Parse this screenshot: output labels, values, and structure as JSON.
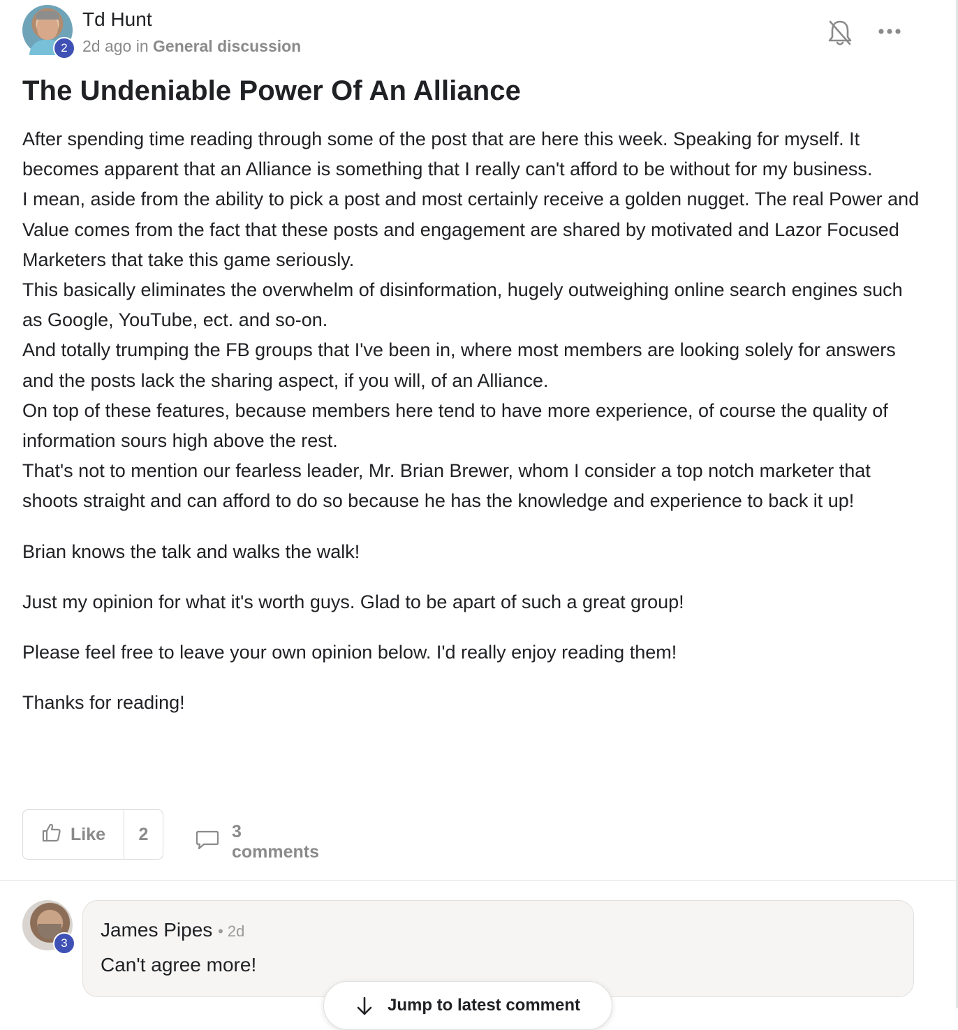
{
  "post": {
    "author": "Td Hunt",
    "author_level": "2",
    "time": "2d ago",
    "in_word": "in",
    "category": "General discussion",
    "title": "The Undeniable Power Of An Alliance",
    "paragraphs": [
      "After spending time reading through some of the post that are here this week. Speaking for myself. It becomes apparent that an Alliance is something that I really can't afford to be without for my business.",
      "I mean, aside from the ability to pick a post and most certainly receive a golden nugget. The real Power and Value comes from the fact that these posts and engagement are shared by motivated and Lazor Focused Marketers that take this game seriously.",
      "This basically eliminates the overwhelm of disinformation, hugely outweighing online search engines such as Google, YouTube, ect. and so-on.",
      "And totally trumping the FB groups that I've been in, where most members are looking solely for answers and the posts lack the sharing aspect, if you will, of an Alliance.",
      "On top of these features, because members here tend to have more experience, of course the quality of information sours high above the rest.",
      "That's not to mention our fearless leader, Mr. Brian Brewer, whom I consider a top notch marketer that shoots straight and can afford to do so because he has the knowledge and experience to back it up!",
      "Brian knows the talk and walks the walk!",
      "Just my opinion for what it's worth guys. Glad to be apart of such a great group!",
      "Please feel free to leave your own opinion below. I'd really enjoy reading them!",
      "Thanks for reading!"
    ],
    "like_label": "Like",
    "like_count": "2",
    "comments_label": "3 comments"
  },
  "icons": {
    "bell": "bell-off-icon",
    "more": "more-horizontal-icon",
    "like": "thumbs-up-icon",
    "comment": "comment-bubble-icon",
    "jump": "arrow-down-icon"
  },
  "comment": {
    "author": "James Pipes",
    "author_level": "3",
    "time": "• 2d",
    "text": "Can't agree more!"
  },
  "jump_button": {
    "label": "Jump to latest comment"
  },
  "colors": {
    "level_badge": "#3f51b5",
    "muted_text": "#8a8a8a",
    "bubble_bg": "#f6f5f4"
  }
}
